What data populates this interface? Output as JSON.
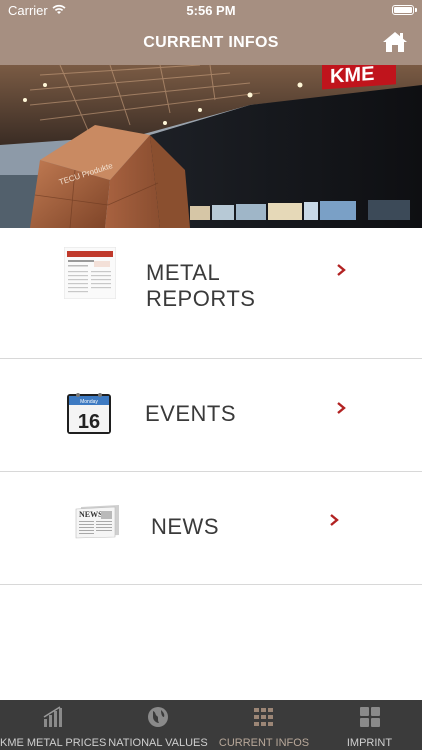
{
  "status_bar": {
    "carrier": "Carrier",
    "time": "5:56 PM"
  },
  "header": {
    "title": "CURRENT INFOS",
    "home_icon": "home-icon"
  },
  "hero": {
    "brand_sign": "KME",
    "booth_text": "TECU Produkte"
  },
  "list": {
    "items": [
      {
        "line1": "METAL",
        "line2": "REPORTS",
        "icon": "document-icon"
      },
      {
        "label": "EVENTS",
        "icon": "calendar-icon",
        "calendar_day": "16",
        "calendar_month": "Monday"
      },
      {
        "label": "NEWS",
        "icon": "newspaper-icon",
        "masthead": "NEWS"
      }
    ]
  },
  "tabs": [
    {
      "label": "KME METAL PRICES",
      "icon": "chart-icon"
    },
    {
      "label": "NATIONAL VALUES",
      "icon": "globe-icon"
    },
    {
      "label": "CURRENT INFOS",
      "icon": "grid-icon",
      "active": true
    },
    {
      "label": "IMPRINT",
      "icon": "tiles-icon"
    }
  ],
  "colors": {
    "header": "#a68f81",
    "chevron": "#b22222",
    "tabbar": "#3b3b3b",
    "active_tab": "#b8a89a"
  }
}
